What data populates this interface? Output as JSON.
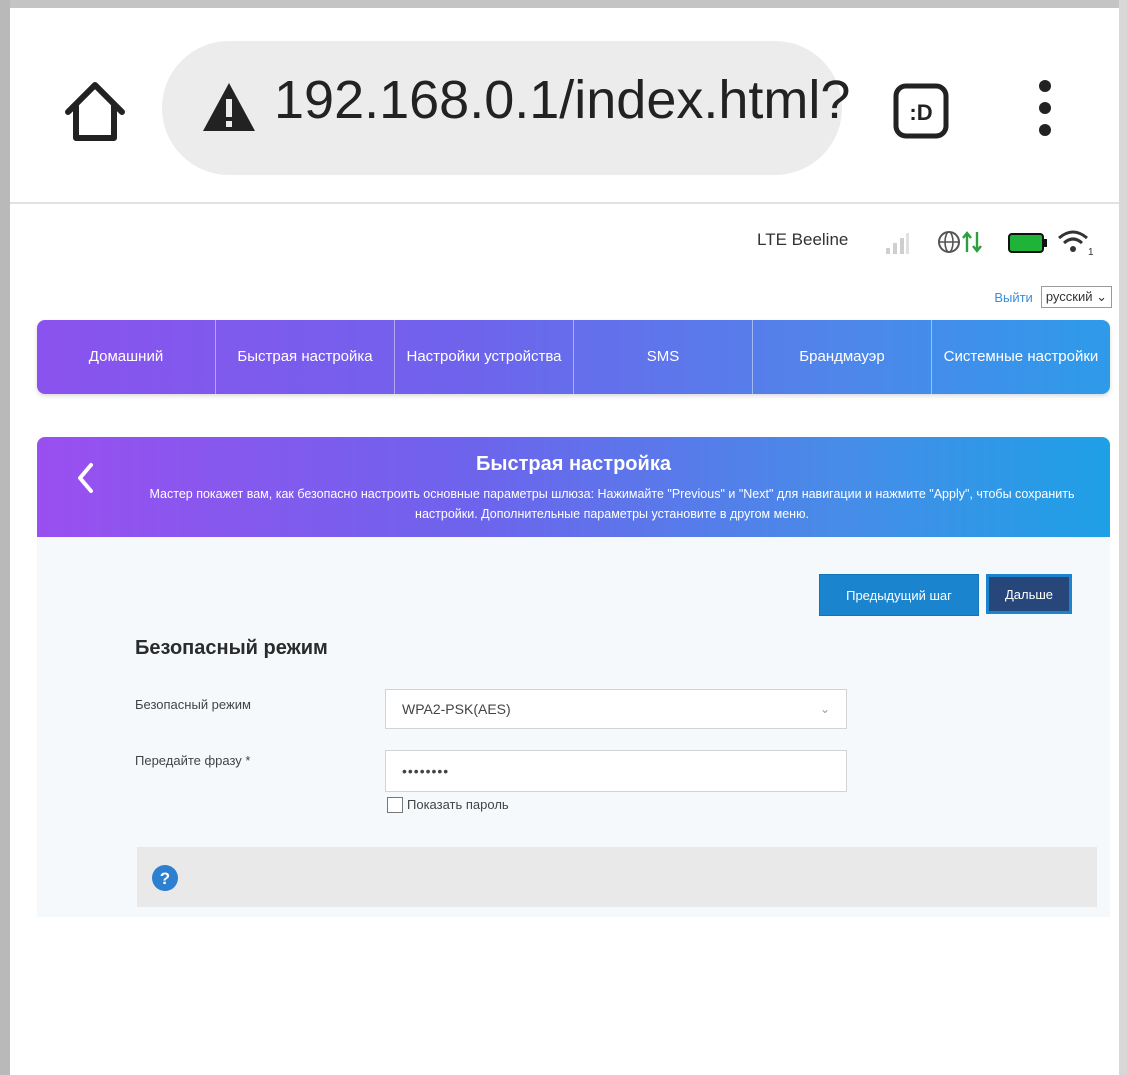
{
  "browser": {
    "url": "192.168.0.1/index.html?",
    "tab_label": ":D"
  },
  "status": {
    "network": "LTE",
    "operator": "Beeline",
    "icons": [
      "signal-icon",
      "globe-icon",
      "data-transfer-icon",
      "battery-icon",
      "wifi-icon"
    ]
  },
  "header": {
    "logout": "Выйти",
    "language": "русский"
  },
  "nav": {
    "items": [
      {
        "label": "Домашний"
      },
      {
        "label": "Быстрая настройка"
      },
      {
        "label": "Настройки устройства"
      },
      {
        "label": "SMS"
      },
      {
        "label": "Брандмауэр"
      },
      {
        "label": "Системные настройки"
      }
    ]
  },
  "panel": {
    "title": "Быстрая настройка",
    "description": "Мастер покажет вам, как безопасно настроить основные параметры шлюза: Нажимайте \"Previous\" и \"Next\" для навигации и нажмите \"Apply\", чтобы сохранить настройки. Дополнительные параметры установите в другом меню.",
    "prev_label": "Предыдущий шаг",
    "next_label": "Дальше"
  },
  "form": {
    "section_title": "Безопасный режим",
    "security_label": "Безопасный режим",
    "security_value": "WPA2-PSK(AES)",
    "passphrase_label": "Передайте фразу *",
    "passphrase_value": "••••••••",
    "show_password_label": "Показать пароль",
    "show_password_checked": false
  },
  "colors": {
    "nav_gradient_start": "#8b52ee",
    "nav_gradient_end": "#2d9be9",
    "button_primary": "#1a84cf",
    "button_active": "#27467a"
  }
}
